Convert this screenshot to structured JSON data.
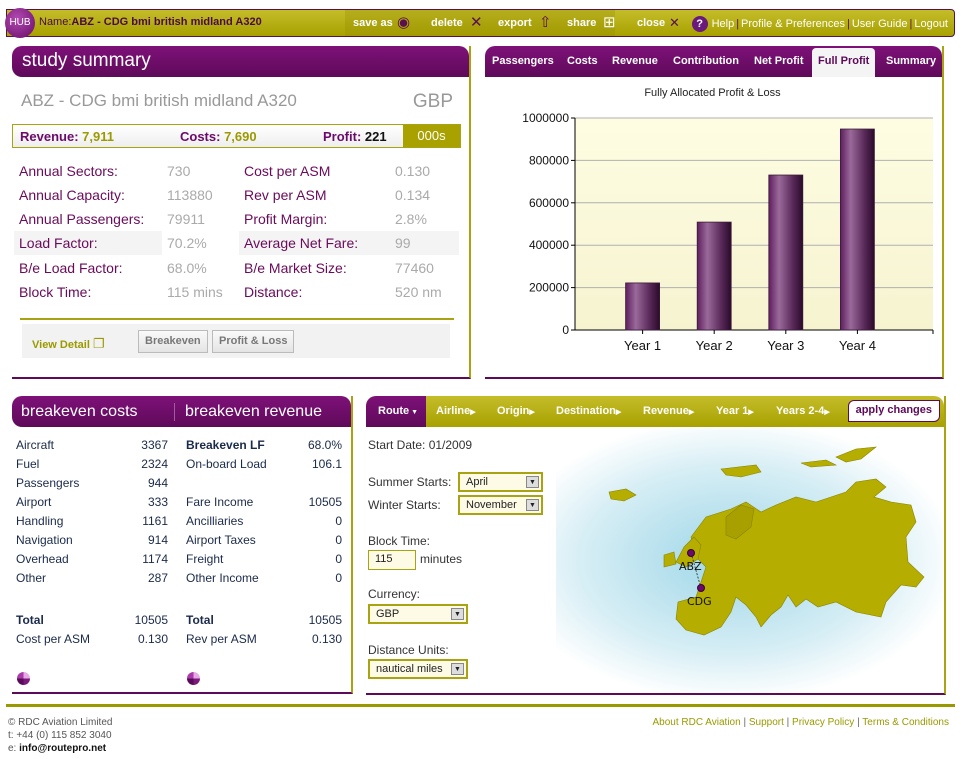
{
  "topbar": {
    "hub_label": "HUB",
    "name_prefix": "Name:",
    "name_value": "ABZ - CDG bmi british midland A320",
    "actions": [
      {
        "label": "save as",
        "icon": "save-icon"
      },
      {
        "label": "delete",
        "icon": "delete-icon"
      },
      {
        "label": "export",
        "icon": "export-icon"
      },
      {
        "label": "share",
        "icon": "share-icon"
      },
      {
        "label": "close",
        "icon": "close-icon"
      }
    ],
    "links": [
      "Help",
      "Profile & Preferences",
      "User Guide",
      "Logout"
    ]
  },
  "study": {
    "header": "study summary",
    "route_title": "ABZ - CDG bmi british midland A320",
    "currency": "GBP",
    "revenue_label": "Revenue:",
    "revenue_value": "7,911",
    "costs_label": "Costs:",
    "costs_value": "7,690",
    "profit_label": "Profit:",
    "profit_value": "221",
    "unit": "000s",
    "rows": [
      {
        "k1": "Annual Sectors:",
        "v1": "730",
        "k2": "Cost per ASM",
        "v2": "0.130"
      },
      {
        "k1": "Annual Capacity:",
        "v1": "113880",
        "k2": "Rev per ASM",
        "v2": "0.134"
      },
      {
        "k1": "Annual Passengers:",
        "v1": "79911",
        "k2": "Profit Margin:",
        "v2": "2.8%"
      },
      {
        "k1": "Load Factor:",
        "v1": "70.2%",
        "k2": "Average Net Fare:",
        "v2": "99"
      },
      {
        "k1": "B/e Load Factor:",
        "v1": "68.0%",
        "k2": "B/e Market Size:",
        "v2": "77460"
      },
      {
        "k1": "Block Time:",
        "v1": "115 mins",
        "k2": "Distance:",
        "v2": "520 nm"
      }
    ],
    "view_detail": "View Detail",
    "breakeven_btn": "Breakeven",
    "pl_btn": "Profit & Loss"
  },
  "chart_tabs": [
    "Passengers",
    "Costs",
    "Revenue",
    "Contribution",
    "Net Profit",
    "Full Profit",
    "Summary"
  ],
  "chart_active_tab": "Full Profit",
  "chart_data": {
    "type": "bar",
    "title": "Fully Allocated Profit & Loss",
    "categories": [
      "Year 1",
      "Year 2",
      "Year 3",
      "Year 4"
    ],
    "values": [
      222000,
      509000,
      731000,
      948000
    ],
    "yticks": [
      "0",
      "200000",
      "400000",
      "600000",
      "800000",
      "1000000"
    ],
    "ylim": [
      0,
      1000000
    ],
    "xlabel": "",
    "ylabel": "",
    "grid": true,
    "colors": {
      "bar": "#6a2a6a",
      "plot_bg": "#fdfbe0",
      "grid": "#b0b0b0"
    }
  },
  "breakeven": {
    "header_costs": "breakeven costs",
    "header_revenue": "breakeven revenue",
    "costs": [
      {
        "k": "Aircraft",
        "v": "3367"
      },
      {
        "k": "Fuel",
        "v": "2324"
      },
      {
        "k": "Passengers",
        "v": "944"
      },
      {
        "k": "Airport",
        "v": "333"
      },
      {
        "k": "Handling",
        "v": "1161"
      },
      {
        "k": "Navigation",
        "v": "914"
      },
      {
        "k": "Overhead",
        "v": "1174"
      },
      {
        "k": "Other",
        "v": "287"
      }
    ],
    "revenue": [
      {
        "k": "Breakeven LF",
        "v": "68.0%"
      },
      {
        "k": "On-board Load",
        "v": "106.1"
      },
      {
        "k": "",
        "v": ""
      },
      {
        "k": "Fare Income",
        "v": "10505"
      },
      {
        "k": "Ancilliaries",
        "v": "0"
      },
      {
        "k": "Airport Taxes",
        "v": "0"
      },
      {
        "k": "Freight",
        "v": "0"
      },
      {
        "k": "Other Income",
        "v": "0"
      }
    ],
    "cost_total_label": "Total",
    "cost_total": "10505",
    "cost_asm_label": "Cost per ASM",
    "cost_asm": "0.130",
    "rev_total_label": "Total",
    "rev_total": "10505",
    "rev_asm_label": "Rev per ASM",
    "rev_asm": "0.130"
  },
  "route": {
    "tabs": [
      "Route",
      "Airline",
      "Origin",
      "Destination",
      "Revenue",
      "Year 1",
      "Years 2-4"
    ],
    "apply": "apply changes",
    "start_date": "Start Date: 01/2009",
    "summer_label": "Summer Starts:",
    "summer_value": "April",
    "winter_label": "Winter Starts:",
    "winter_value": "November",
    "block_label": "Block Time:",
    "block_value": "115",
    "block_unit": "minutes",
    "currency_label": "Currency:",
    "currency_value": "GBP",
    "distance_label": "Distance Units:",
    "distance_value": "nautical miles",
    "map_origin": "ABZ",
    "map_destination": "CDG"
  },
  "footer": {
    "company": "© RDC Aviation Limited",
    "phone": "t: +44 (0) 115 852 3040",
    "email_prefix": "e: ",
    "email": "info@routepro.net",
    "links": [
      "About RDC Aviation",
      "Support",
      "Privacy Policy",
      "Terms & Conditions"
    ]
  }
}
